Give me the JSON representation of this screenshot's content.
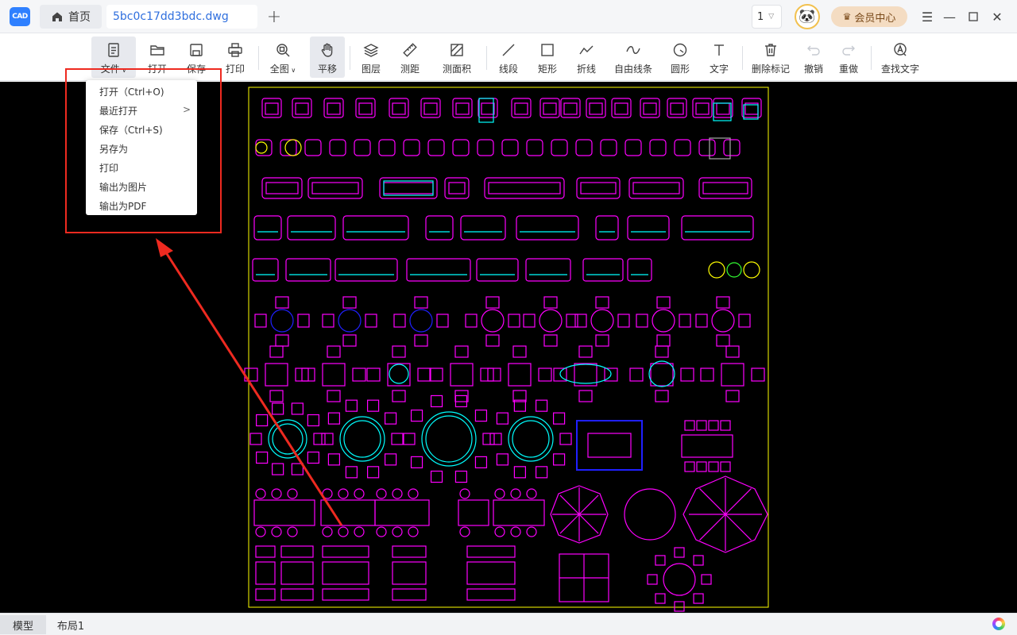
{
  "titlebar": {
    "logo_text": "CAD",
    "home_tab": "首页",
    "file_tab": "5bc0c17dd3bdc.dwg",
    "add_tab": "+",
    "page_number": "1",
    "vip_label": "会员中心"
  },
  "toolbar": {
    "items": [
      {
        "label": "文件",
        "icon": "file-icon",
        "has_menu": true
      },
      {
        "label": "打开",
        "icon": "folder-open-icon"
      },
      {
        "label": "保存",
        "icon": "save-icon"
      },
      {
        "label": "打印",
        "icon": "printer-icon"
      },
      {
        "label": "全图",
        "icon": "zoom-extents-icon",
        "has_menu": true
      },
      {
        "label": "平移",
        "icon": "hand-pan-icon"
      },
      {
        "label": "图层",
        "icon": "layers-icon"
      },
      {
        "label": "测距",
        "icon": "ruler-icon"
      },
      {
        "label": "测面积",
        "icon": "area-measure-icon"
      },
      {
        "label": "线段",
        "icon": "line-segment-icon"
      },
      {
        "label": "矩形",
        "icon": "rectangle-icon"
      },
      {
        "label": "折线",
        "icon": "polyline-icon"
      },
      {
        "label": "自由线条",
        "icon": "freehand-line-icon"
      },
      {
        "label": "圆形",
        "icon": "circle-icon"
      },
      {
        "label": "文字",
        "icon": "text-icon"
      },
      {
        "label": "删除标记",
        "icon": "trash-icon"
      },
      {
        "label": "撤销",
        "icon": "undo-icon"
      },
      {
        "label": "重做",
        "icon": "redo-icon"
      },
      {
        "label": "查找文字",
        "icon": "find-text-icon"
      }
    ]
  },
  "file_menu": {
    "items": [
      {
        "label": "打开（Ctrl+O)"
      },
      {
        "label": "最近打开",
        "submenu": ">"
      },
      {
        "label": "保存（Ctrl+S)"
      },
      {
        "label": "另存为"
      },
      {
        "label": "打印"
      },
      {
        "label": "输出为图片"
      },
      {
        "label": "输出为PDF"
      }
    ]
  },
  "statusbar": {
    "tabs": [
      {
        "label": "模型",
        "active": true
      },
      {
        "label": "布局1",
        "active": false
      }
    ]
  },
  "colors": {
    "accent": "#2f80ff",
    "annotation_red": "#ee2a20",
    "cad_magenta": "#ff00ff",
    "cad_cyan": "#00ffff",
    "cad_yellow": "#ffff00",
    "cad_blue": "#0000ff",
    "canvas_bg": "#000000"
  }
}
